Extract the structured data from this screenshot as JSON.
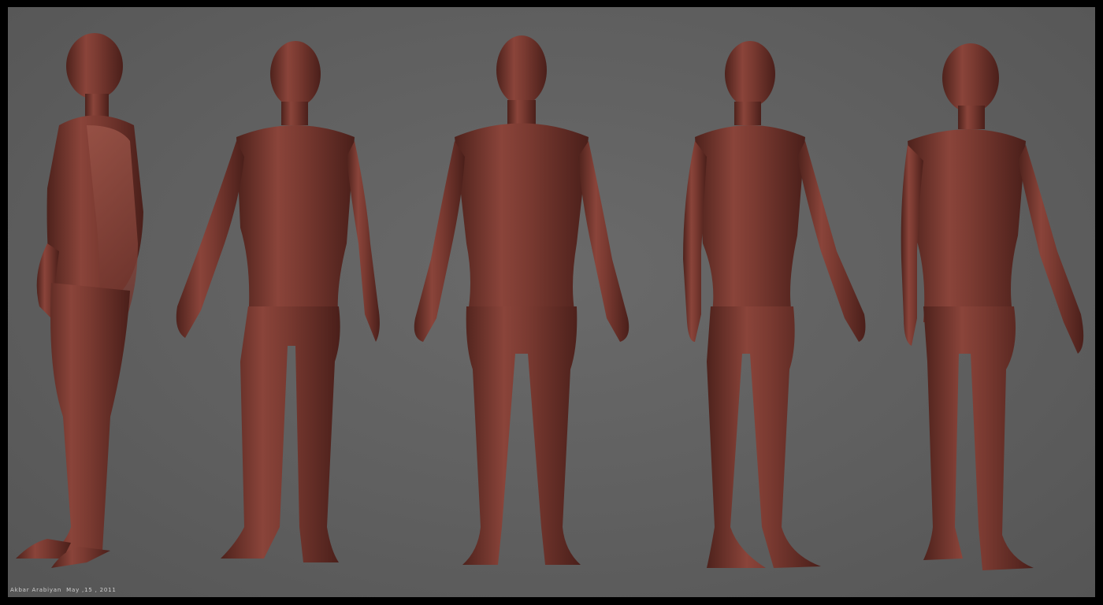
{
  "caption": "Akbar Arabiyan  May ,15 , 2011",
  "colors": {
    "background": "#5f5f5f",
    "frame": "#000000",
    "clay": "#7a3a32",
    "clay_light": "#a05a4e",
    "clay_dark": "#4a1f1a"
  },
  "figures": [
    {
      "name": "figure-side-view",
      "view": "side"
    },
    {
      "name": "figure-three-quarter-left",
      "view": "three-quarter"
    },
    {
      "name": "figure-front-view",
      "view": "front"
    },
    {
      "name": "figure-three-quarter-right",
      "view": "three-quarter"
    },
    {
      "name": "figure-back-view",
      "view": "back"
    }
  ]
}
